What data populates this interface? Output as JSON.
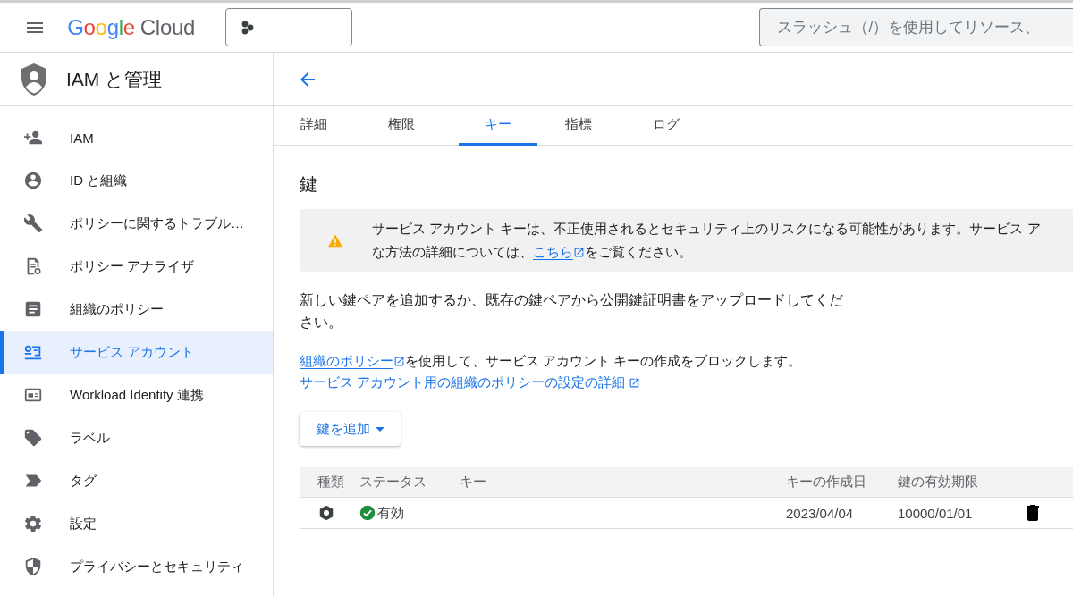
{
  "header": {
    "logo": {
      "brand": "Google",
      "product": "Cloud"
    },
    "search": {
      "placeholder": "スラッシュ（/）を使用してリソース、"
    }
  },
  "sidebar": {
    "title": "IAM と管理",
    "items": [
      {
        "label": "IAM",
        "selected": false
      },
      {
        "label": "ID と組織",
        "selected": false
      },
      {
        "label": "ポリシーに関するトラブル…",
        "selected": false
      },
      {
        "label": "ポリシー アナライザ",
        "selected": false
      },
      {
        "label": "組織のポリシー",
        "selected": false
      },
      {
        "label": "サービス アカウント",
        "selected": true
      },
      {
        "label": "Workload Identity 連携",
        "selected": false
      },
      {
        "label": "ラベル",
        "selected": false
      },
      {
        "label": "タグ",
        "selected": false
      },
      {
        "label": "設定",
        "selected": false
      },
      {
        "label": "プライバシーとセキュリティ",
        "selected": false
      }
    ]
  },
  "tabs": [
    {
      "label": "詳細",
      "selected": false
    },
    {
      "label": "権限",
      "selected": false
    },
    {
      "label": "キー",
      "selected": true
    },
    {
      "label": "指標",
      "selected": false
    },
    {
      "label": "ログ",
      "selected": false
    }
  ],
  "section_title": "鍵",
  "warning": {
    "line_1": "サービス アカウント キーは、不正使用されるとセキュリティ上のリスクになる可能性があります。サービス ア",
    "line_2_before": "な方法の詳細については、",
    "line_2_link": "こちら",
    "line_2_after": "をご覧ください。"
  },
  "description": "新しい鍵ペアを追加するか、既存の鍵ペアから公開鍵証明書をアップロードしてください。",
  "policy": {
    "link": "組織のポリシー",
    "text": "を使用して、サービス アカウント キーの作成をブロックします。",
    "details_link": "サービス アカウント用の組織のポリシーの設定の詳細"
  },
  "add_button": "鍵を追加",
  "table": {
    "columns": [
      "種類",
      "ステータス",
      "キー",
      "キーの作成日",
      "鍵の有効期限"
    ],
    "rows": [
      {
        "status": "有効",
        "created": "2023/04/04",
        "expires": "10000/01/01"
      }
    ]
  }
}
